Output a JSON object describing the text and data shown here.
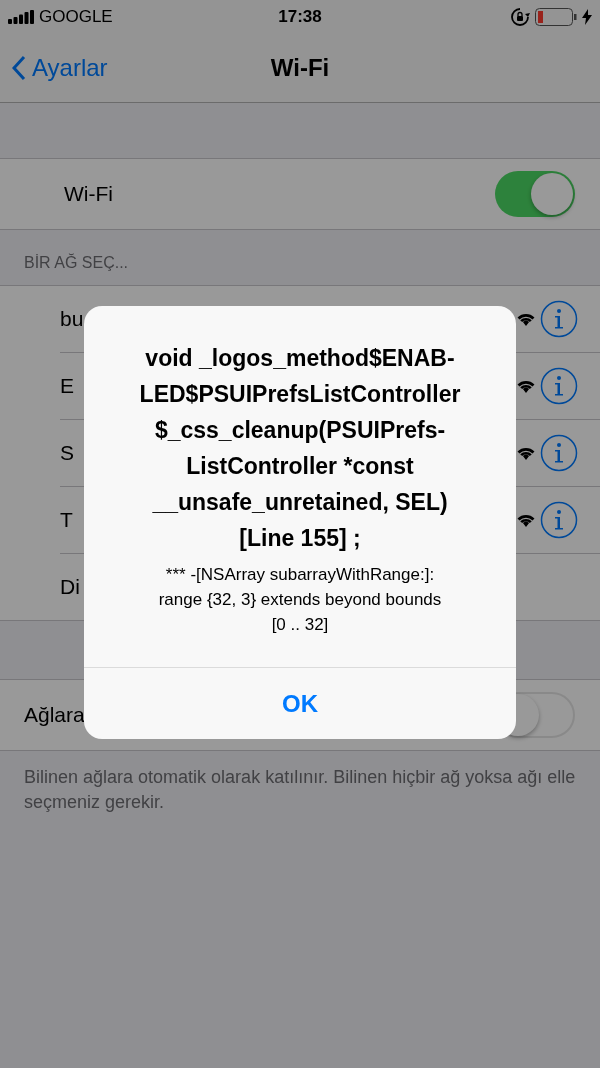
{
  "status_bar": {
    "carrier": "GOOGLE",
    "time": "17:38"
  },
  "nav": {
    "back": "Ayarlar",
    "title": "Wi-Fi"
  },
  "wifi_row": {
    "label": "Wi-Fi",
    "on": true
  },
  "section_header": "BİR AĞ SEÇ...",
  "networks": [
    {
      "name": "bu",
      "kind": "network"
    },
    {
      "name": "E",
      "kind": "network"
    },
    {
      "name": "S",
      "kind": "network"
    },
    {
      "name": "T",
      "kind": "network"
    },
    {
      "name": "Di",
      "kind": "other"
    }
  ],
  "ask_row": {
    "label": "Ağlara",
    "on": false
  },
  "footer": "Bilinen ağlara otomatik olarak katılınır. Bilinen hiçbir ağ yoksa ağı elle seçmeniz gerekir.",
  "alert": {
    "title": "void _logos_method$ENAB-\nLED$PSUIPrefsListController\n$_css_cleanup(PSUIPrefs-\nListController *const\n__unsafe_unretained, SEL)\n[Line 155] ;",
    "message": "*** -[NSArray subarrayWithRange:]:\nrange {32, 3} extends beyond bounds\n[0 .. 32]",
    "button": "OK"
  }
}
